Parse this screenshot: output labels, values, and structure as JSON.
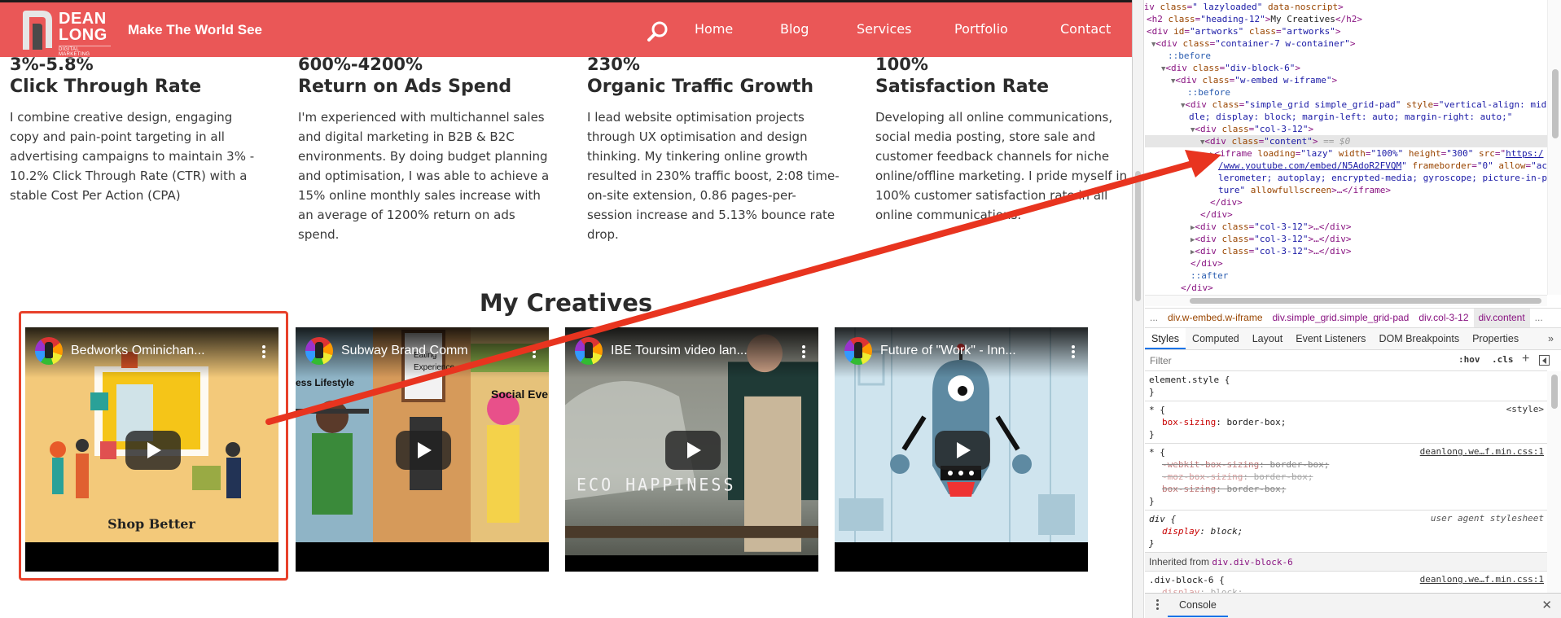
{
  "site": {
    "logo": {
      "line1": "DEAN",
      "line2": "LONG",
      "line3": "DIGITAL MARKETING"
    },
    "tagline": "Make The World See",
    "nav": [
      {
        "label": "Home"
      },
      {
        "label": "Blog"
      },
      {
        "label": "Services"
      },
      {
        "label": "Portfolio"
      },
      {
        "label": "Contact"
      }
    ],
    "brand_color": "#ea5757"
  },
  "stats": [
    {
      "value": "3%-5.8%",
      "title": "Click Through Rate",
      "desc": "I combine creative design, engaging copy and pain-point targeting in all advertising campaigns to maintain 3% - 10.2% Click Through Rate (CTR) with a stable Cost Per Action (CPA)"
    },
    {
      "value": "600%-4200%",
      "title": "Return on Ads Spend",
      "desc": "I'm experienced with multichannel sales and digital marketing in B2B & B2C environments. By doing budget planning and optimisation, I was able to achieve a 15% online monthly sales increase with an average of 1200% return on ads spend."
    },
    {
      "value": "230%",
      "title": "Organic Traffic Growth",
      "desc": "I lead website optimisation projects through UX optimisation and design thinking. My tinkering online growth resulted in 230% traffic boost, 2:08 time-on-site extension, 0.86 pages-per-session increase and 5.13% bounce rate drop."
    },
    {
      "value": "100%",
      "title": "Satisfaction Rate",
      "desc": "Developing all online communications, social media posting, store sale and customer feedback channels for niche online/offline marketing. I pride myself in 100% customer satisfaction rate in all online communications."
    }
  ],
  "creatives": {
    "heading": "My Creatives",
    "videos": [
      {
        "title": "Bedworks Ominichan...",
        "overlay_text": [
          "Shop Better"
        ],
        "highlighted": true
      },
      {
        "title": "Subway Brand Comm",
        "overlay_text": [
          "ess Lifestyle",
          "Eating",
          "Experience",
          "Social Event"
        ],
        "highlighted": false
      },
      {
        "title": "IBE Toursim video lan...",
        "overlay_text": [
          "ECO HAPPINESS"
        ],
        "highlighted": false
      },
      {
        "title": "Future of \"Work\" - Inn...",
        "overlay_text": [],
        "highlighted": false
      }
    ]
  },
  "devtools": {
    "dom": {
      "l0": {
        "tag": "div",
        "attr": "class",
        "val": "\" lazyloaded\"",
        "extra": "data-noscript"
      },
      "l1": {
        "tag": "h2",
        "attr": "class",
        "val": "\"heading-12\"",
        "text": "My Creatives"
      },
      "l2": {
        "tag": "div",
        "attr1": "id",
        "val1": "\"artworks\"",
        "attr2": "class",
        "val2": "\"artworks\""
      },
      "l3": {
        "tag": "div",
        "attr": "class",
        "val": "\"container-7 w-container\""
      },
      "before": "::before",
      "after": "::after",
      "l5": {
        "tag": "div",
        "attr": "class",
        "val": "\"div-block-6\""
      },
      "l6": {
        "tag": "div",
        "attr": "class",
        "val": "\"w-embed w-iframe\""
      },
      "l8a": {
        "tag": "div",
        "attr1": "class",
        "val1": "\"simple_grid simple_grid-pad\"",
        "attr2": "style",
        "val2a": "\"vertical-align: mid"
      },
      "l8b": "dle; display: block; margin-left: auto; margin-right: auto;\"",
      "l9": {
        "tag": "div",
        "attr": "class",
        "val": "\"col-3-12\""
      },
      "l10": {
        "tag": "div",
        "attr": "class",
        "val": "\"content\"",
        "sel": "== $0"
      },
      "l11a": {
        "tag": "iframe",
        "a1": "loading",
        "v1": "\"lazy\"",
        "a2": "width",
        "v2": "\"100%\"",
        "a3": "height",
        "v3": "\"300\"",
        "a4": "src",
        "v4a": "https:/"
      },
      "l11b": {
        "link": "/www.youtube.com/embed/N5AdoR2FVQM",
        "a5": "frameborder",
        "v5": "\"0\"",
        "a6": "allow",
        "v6a": "\"acce"
      },
      "l11c": "lerometer; autoplay; encrypted-media; gyroscope; picture-in-pic",
      "l11d": {
        "v6b": "ture\"",
        "a7": "allowfullscreen",
        "close": "…</iframe>"
      },
      "close_div": "</div>",
      "collapsed": {
        "tag": "div",
        "attr": "class",
        "val": "\"col-3-12\"",
        "tail": "…</div>"
      }
    },
    "breadcrumbs": [
      "...",
      "div.w-embed.w-iframe",
      "div.simple_grid.simple_grid-pad",
      "div.col-3-12",
      "div.content",
      "..."
    ],
    "tabs": [
      "Styles",
      "Computed",
      "Layout",
      "Event Listeners",
      "DOM Breakpoints",
      "Properties",
      "»"
    ],
    "active_tab": "Styles",
    "filter": {
      "placeholder": "Filter",
      "hov": ":hov",
      "cls": ".cls",
      "plus": "+"
    },
    "styles": {
      "element_style": "element.style {",
      "r1": {
        "selector": "* {",
        "source": "<style>",
        "prop": "box-sizing",
        "value": "border-box;"
      },
      "r2": {
        "selector": "* {",
        "source": "deanlong.we…f.min.css:1",
        "p1": "-webkit-box-sizing",
        "v1": "border-box;",
        "p2": "-moz-box-sizing",
        "v2": "border-box;",
        "p3": "box-sizing",
        "v3": "border-box;"
      },
      "r3": {
        "selector": "div {",
        "source": "user agent stylesheet",
        "prop": "display",
        "value": "block;"
      },
      "inherited_label": "Inherited from",
      "inherited_sel": "div.div-block-6",
      "r4": {
        "selector": ".div-block-6 {",
        "source": "deanlong.we…f.min.css:1",
        "prop": "display",
        "value": "block;"
      },
      "close": "}"
    },
    "drawer": {
      "tab": "Console",
      "close": "✕"
    }
  }
}
